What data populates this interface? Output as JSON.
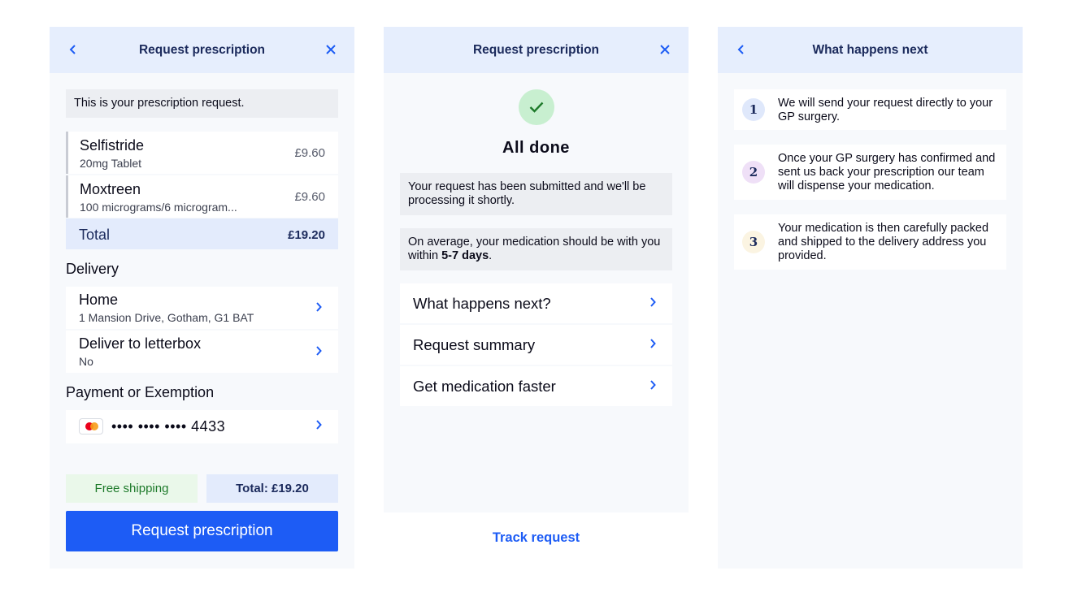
{
  "panel1": {
    "header": {
      "title": "Request prescription"
    },
    "intro": "This is your prescription request.",
    "items": [
      {
        "name": "Selfistride",
        "desc": "20mg Tablet",
        "price": "£9.60"
      },
      {
        "name": "Moxtreen",
        "desc": "100 micrograms/6 microgram...",
        "price": "£9.60"
      }
    ],
    "total": {
      "label": "Total",
      "value": "£19.20"
    },
    "delivery": {
      "heading": "Delivery",
      "rows": [
        {
          "title": "Home",
          "sub": "1 Mansion Drive, Gotham, G1 BAT"
        },
        {
          "title": "Deliver to letterbox",
          "sub": "No"
        }
      ]
    },
    "payment": {
      "heading": "Payment or Exemption",
      "card_number": "•••• •••• •••• 4433",
      "card_icon": "mastercard-icon"
    },
    "shipping": "Free shipping",
    "grand_total": "Total: £19.20",
    "cta": "Request prescription"
  },
  "panel2": {
    "header": {
      "title": "Request prescription"
    },
    "done": "All done",
    "msg1": "Your request has been submitted and we'll be processing it shortly.",
    "msg2_prefix": "On average, your medication should be with you within ",
    "msg2_bold": "5-7 days",
    "msg2_suffix": ".",
    "links": [
      "What happens next?",
      "Request summary",
      "Get medication faster"
    ],
    "track": "Track request"
  },
  "panel3": {
    "header": {
      "title": "What happens next"
    },
    "steps": [
      {
        "num": "1",
        "text": "We will send your request directly to your GP surgery."
      },
      {
        "num": "2",
        "text": "Once your GP surgery has confirmed and sent us back your prescription our team will dispense your medication."
      },
      {
        "num": "3",
        "text": "Your medication is then carefully packed and shipped to the delivery address you provided."
      }
    ]
  },
  "colors": {
    "header_bg": "#e6eefd",
    "primary": "#1d5cf5",
    "navy": "#1b2a5c",
    "success_bg": "#c8efd0",
    "success": "#1d7a2a",
    "step1_bg": "#dfe8fb",
    "step2_bg": "#efe0f7",
    "step3_bg": "#fbf4e2"
  }
}
